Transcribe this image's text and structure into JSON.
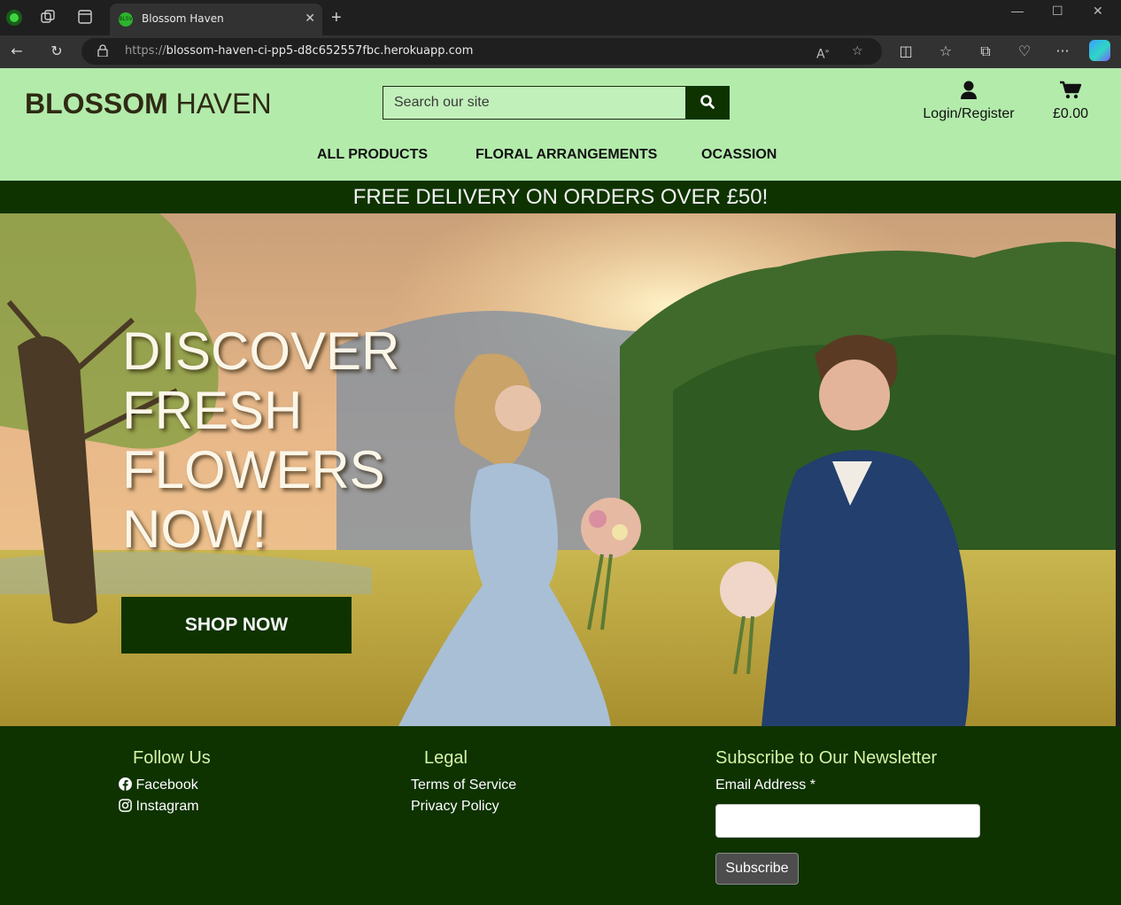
{
  "browser": {
    "tab_title": "Blossom Haven",
    "favicon_text": "BLSV",
    "url_scheme": "https://",
    "url_host": "blossom-haven-ci-pp5-d8c652557fbc.herokuapp.com"
  },
  "header": {
    "logo_bold": "BLOSSOM",
    "logo_light": " HAVEN",
    "search_placeholder": "Search our site",
    "account_label": "Login/Register",
    "cart_total": "£0.00"
  },
  "nav": {
    "items": [
      {
        "label": "ALL PRODUCTS"
      },
      {
        "label": "FLORAL ARRANGEMENTS"
      },
      {
        "label": "OCASSION"
      }
    ]
  },
  "banner": {
    "text": "FREE DELIVERY ON ORDERS OVER £50!"
  },
  "hero": {
    "headline": [
      "DISCOVER",
      "FRESH",
      "FLOWERS",
      "NOW!"
    ],
    "cta_label": "SHOP NOW"
  },
  "footer": {
    "follow": {
      "heading": "Follow Us",
      "links": [
        {
          "label": "Facebook",
          "icon": "facebook-icon"
        },
        {
          "label": "Instagram",
          "icon": "instagram-icon"
        }
      ]
    },
    "legal": {
      "heading": "Legal",
      "links": [
        {
          "label": "Terms of Service"
        },
        {
          "label": "Privacy Policy"
        }
      ]
    },
    "newsletter": {
      "heading": "Subscribe to Our Newsletter",
      "email_label": "Email Address *",
      "email_value": "",
      "button_label": "Subscribe"
    }
  },
  "colors": {
    "header_bg": "#b3ebab",
    "dark_green": "#0e3300",
    "footer_heading": "#d7f3a8"
  }
}
